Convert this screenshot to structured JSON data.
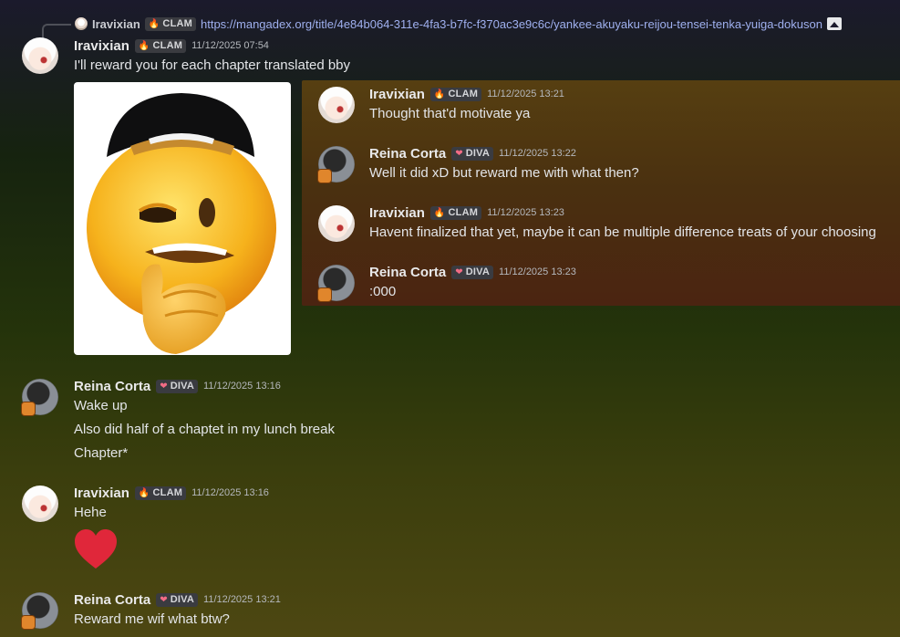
{
  "reply": {
    "author": "Iravixian",
    "tag": "CLAM",
    "link": "https://mangadex.org/title/4e84b064-311e-4fa3-b7fc-f370ac3e9c6c/yankee-akuyaku-reijou-tensei-tenka-yuiga-dokuson"
  },
  "messages": [
    {
      "author": "Iravixian",
      "tag": "CLAM",
      "time": "11/12/2025 07:54",
      "lines": [
        "I'll reward you for each chapter translated bby"
      ]
    },
    {
      "author": "Reina Corta",
      "tag": "DIVA",
      "time": "11/12/2025 13:16",
      "lines": [
        "Wake up",
        "Also did half of a chaptet in my lunch break",
        "Chapter*"
      ]
    },
    {
      "author": "Iravixian",
      "tag": "CLAM",
      "time": "11/12/2025 13:16",
      "lines": [
        "Hehe"
      ]
    },
    {
      "author": "Reina Corta",
      "tag": "DIVA",
      "time": "11/12/2025 13:21",
      "lines": [
        "Reward me wif what btw?"
      ]
    }
  ],
  "panel_messages": [
    {
      "author": "Iravixian",
      "tag": "CLAM",
      "time": "11/12/2025 13:21",
      "text": "Thought that'd motivate ya"
    },
    {
      "author": "Reina Corta",
      "tag": "DIVA",
      "time": "11/12/2025 13:22",
      "text": "Well it did xD but reward me with what then?"
    },
    {
      "author": "Iravixian",
      "tag": "CLAM",
      "time": "11/12/2025 13:23",
      "text": "Havent finalized that yet, maybe it can be multiple difference treats of your choosing"
    },
    {
      "author": "Reina Corta",
      "tag": "DIVA",
      "time": "11/12/2025 13:23",
      "text": ":000"
    }
  ],
  "icons": {
    "clam_tag": "fire-icon",
    "diva_tag": "heart-icon",
    "reply_image": "image-icon",
    "attachment": "smirking-emoji-with-cap",
    "reaction_emoji": "red-heart-emoji"
  },
  "colors": {
    "link": "#9fb0ef",
    "tag_bg": "#3a3b40",
    "heart": "#e0273a"
  }
}
